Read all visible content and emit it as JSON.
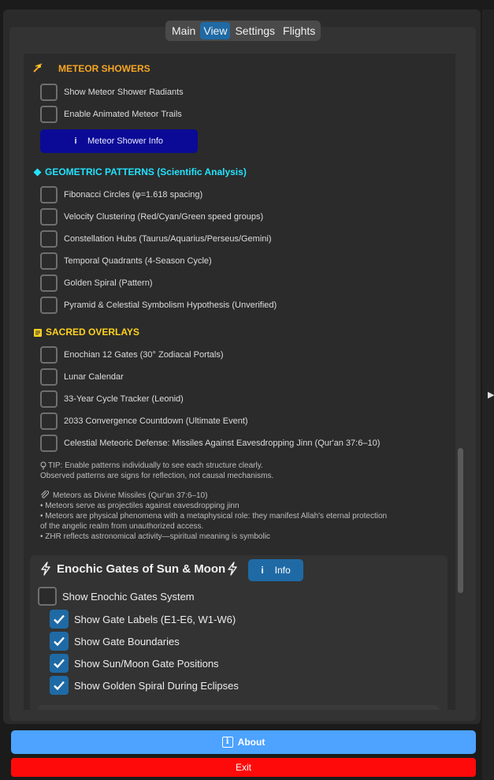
{
  "tabs": [
    {
      "label": "Main",
      "active": false
    },
    {
      "label": "View",
      "active": true
    },
    {
      "label": "Settings",
      "active": false
    },
    {
      "label": "Flights",
      "active": false
    }
  ],
  "meteor": {
    "title": "METEOR SHOWERS",
    "icon": "meteor-icon",
    "items": [
      {
        "label": "Show Meteor Shower Radiants",
        "checked": false
      },
      {
        "label": "Enable Animated Meteor Trails",
        "checked": false
      }
    ],
    "info_button": "Meteor Shower Info",
    "info_glyph": "i"
  },
  "geometric": {
    "title": "GEOMETRIC PATTERNS (Scientific Analysis)",
    "icon": "diamond-icon",
    "items": [
      {
        "label": "Fibonacci Circles (φ=1.618 spacing)",
        "checked": false
      },
      {
        "label": "Velocity Clustering (Red/Cyan/Green speed groups)",
        "checked": false
      },
      {
        "label": "Constellation Hubs (Taurus/Aquarius/Perseus/Gemini)",
        "checked": false
      },
      {
        "label": "Temporal Quadrants (4-Season Cycle)",
        "checked": false
      },
      {
        "label": "Golden Spiral (Pattern)",
        "checked": false
      },
      {
        "label": "Pyramid & Celestial Symbolism Hypothesis (Unverified)",
        "checked": false
      }
    ]
  },
  "sacred": {
    "title": "SACRED OVERLAYS",
    "icon": "scroll-icon",
    "items": [
      {
        "label": "Enochian 12 Gates (30° Zodiacal Portals)",
        "checked": false
      },
      {
        "label": "Lunar Calendar",
        "checked": false
      },
      {
        "label": "33-Year Cycle Tracker (Leonid)",
        "checked": false
      },
      {
        "label": "2033 Convergence Countdown (Ultimate Event)",
        "checked": false
      },
      {
        "label": "Celestial Meteoric Defense: Missiles Against Eavesdropping Jinn (Qur'an 37:6–10)",
        "checked": false
      }
    ]
  },
  "notes": {
    "tip_line1": "TIP: Enable patterns individually to see each structure clearly.",
    "tip_line2": "Observed patterns are signs for reflection, not causal mechanisms.",
    "missile_title": "Meteors as Divine Missiles (Qur'an 37:6–10)",
    "missile_lines": [
      "• Meteors serve as projectiles against eavesdropping jinn",
      "• Meteors are physical phenomena with a metaphysical role: they manifest Allah's eternal protection",
      "of the angelic realm from unauthorized access.",
      "• ZHR reflects astronomical activity—spiritual meaning is symbolic"
    ]
  },
  "gates": {
    "title": "Enochic Gates of Sun & Moon",
    "info_label": "Info",
    "info_glyph": "i",
    "main_toggle": {
      "label": "Show Enochic Gates System",
      "checked": false
    },
    "items": [
      {
        "label": "Show Gate Labels (E1-E6, W1-W6)",
        "checked": true
      },
      {
        "label": "Show Gate Boundaries",
        "checked": true
      },
      {
        "label": "Show Sun/Moon Gate Positions",
        "checked": true
      },
      {
        "label": "Show Golden Spiral During Eclipses",
        "checked": true
      }
    ]
  },
  "footer": {
    "about_label": "About",
    "about_glyph": "i",
    "exit_label": "Exit"
  },
  "colors": {
    "accent": "#1f6aa5",
    "meteor_title": "#f5a623",
    "geometric_title": "#22e3ff",
    "sacred_title": "#ffd21f",
    "about_bg": "#4da3ff",
    "exit_bg": "#ff0a0a",
    "info_bg": "#0a0a96"
  }
}
